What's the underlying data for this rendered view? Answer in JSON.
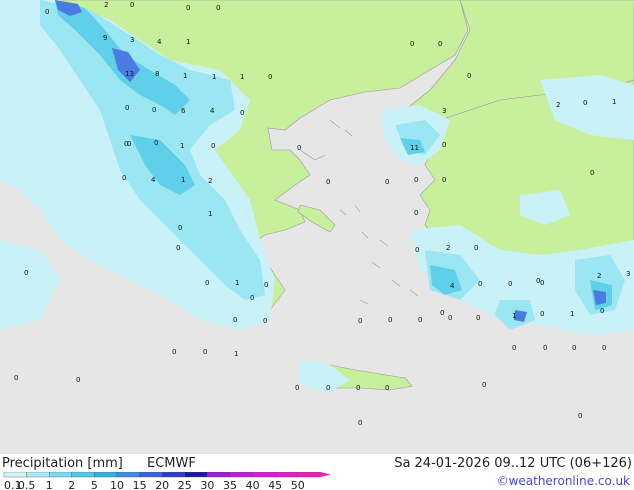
{
  "footer": {
    "product": "Precipitation [mm]",
    "model": "ECMWF",
    "valid_time": "Sa 24-01-2026 09..12 UTC (06+126)",
    "credit": "©weatheronline.co.uk"
  },
  "legend": {
    "values": [
      "0.1",
      "0.5",
      "1",
      "2",
      "5",
      "10",
      "15",
      "20",
      "25",
      "30",
      "35",
      "40",
      "45",
      "50"
    ],
    "colors": [
      "#d2f3f8",
      "#a8eaf4",
      "#7adcf0",
      "#4ecae8",
      "#2fb2e0",
      "#3c8ee6",
      "#3a64dc",
      "#2c3cc8",
      "#1a1aa0",
      "#9c1ce0",
      "#c01ce0",
      "#dc1cdc",
      "#e81cc8",
      "#f01cb4"
    ]
  },
  "map": {
    "colors": {
      "sea": "#e6e6e6",
      "land": "#c8ef9c",
      "precip_light": "#c8f2f8",
      "precip_mid": "#9ae6f2",
      "precip_heavy": "#60cfea",
      "precip_max": "#4a7be0"
    },
    "values": [
      {
        "t": "2"
      },
      {
        "t": "0"
      },
      {
        "t": "0"
      },
      {
        "t": "0"
      },
      {
        "t": "9"
      },
      {
        "t": "3"
      },
      {
        "t": "4"
      },
      {
        "t": "1"
      },
      {
        "t": "0"
      },
      {
        "t": "0"
      },
      {
        "t": "13"
      },
      {
        "t": "8"
      },
      {
        "t": "1"
      },
      {
        "t": "1"
      },
      {
        "t": "1"
      },
      {
        "t": "0"
      },
      {
        "t": "0"
      },
      {
        "t": "0"
      },
      {
        "t": "6"
      },
      {
        "t": "4"
      },
      {
        "t": "0"
      },
      {
        "t": "0"
      },
      {
        "t": "1"
      },
      {
        "t": "0"
      },
      {
        "t": "0"
      },
      {
        "t": "4"
      },
      {
        "t": "2"
      },
      {
        "t": "1"
      },
      {
        "t": "0"
      },
      {
        "t": "0"
      },
      {
        "t": "0"
      },
      {
        "t": "0"
      },
      {
        "t": "0"
      },
      {
        "t": "0"
      },
      {
        "t": "0"
      },
      {
        "t": "1"
      },
      {
        "t": "0"
      },
      {
        "t": "0"
      },
      {
        "t": "0"
      },
      {
        "t": "0"
      },
      {
        "t": "0"
      },
      {
        "t": "0"
      },
      {
        "t": "1"
      },
      {
        "t": "0"
      },
      {
        "t": "0"
      },
      {
        "t": "0"
      },
      {
        "t": "0"
      },
      {
        "t": "0"
      },
      {
        "t": "0"
      },
      {
        "t": "0"
      },
      {
        "t": "0"
      },
      {
        "t": "0"
      },
      {
        "t": "0"
      },
      {
        "t": "0"
      },
      {
        "t": "0"
      },
      {
        "t": "0"
      },
      {
        "t": "0"
      },
      {
        "t": "0"
      },
      {
        "t": "0"
      },
      {
        "t": "2"
      },
      {
        "t": "0"
      },
      {
        "t": "1"
      },
      {
        "t": "3"
      },
      {
        "t": "11"
      },
      {
        "t": "0"
      },
      {
        "t": "0"
      },
      {
        "t": "0"
      },
      {
        "t": "0"
      },
      {
        "t": "0"
      },
      {
        "t": "0"
      },
      {
        "t": "0"
      },
      {
        "t": "2"
      },
      {
        "t": "0"
      },
      {
        "t": "1"
      },
      {
        "t": "4"
      },
      {
        "t": "0"
      },
      {
        "t": "0"
      },
      {
        "t": "1"
      },
      {
        "t": "0"
      },
      {
        "t": "0"
      },
      {
        "t": "2"
      },
      {
        "t": "3"
      },
      {
        "t": "0"
      },
      {
        "t": "1"
      },
      {
        "t": "0"
      },
      {
        "t": "0"
      },
      {
        "t": "0"
      },
      {
        "t": "0"
      },
      {
        "t": "0"
      },
      {
        "t": "0"
      },
      {
        "t": "0"
      }
    ]
  }
}
